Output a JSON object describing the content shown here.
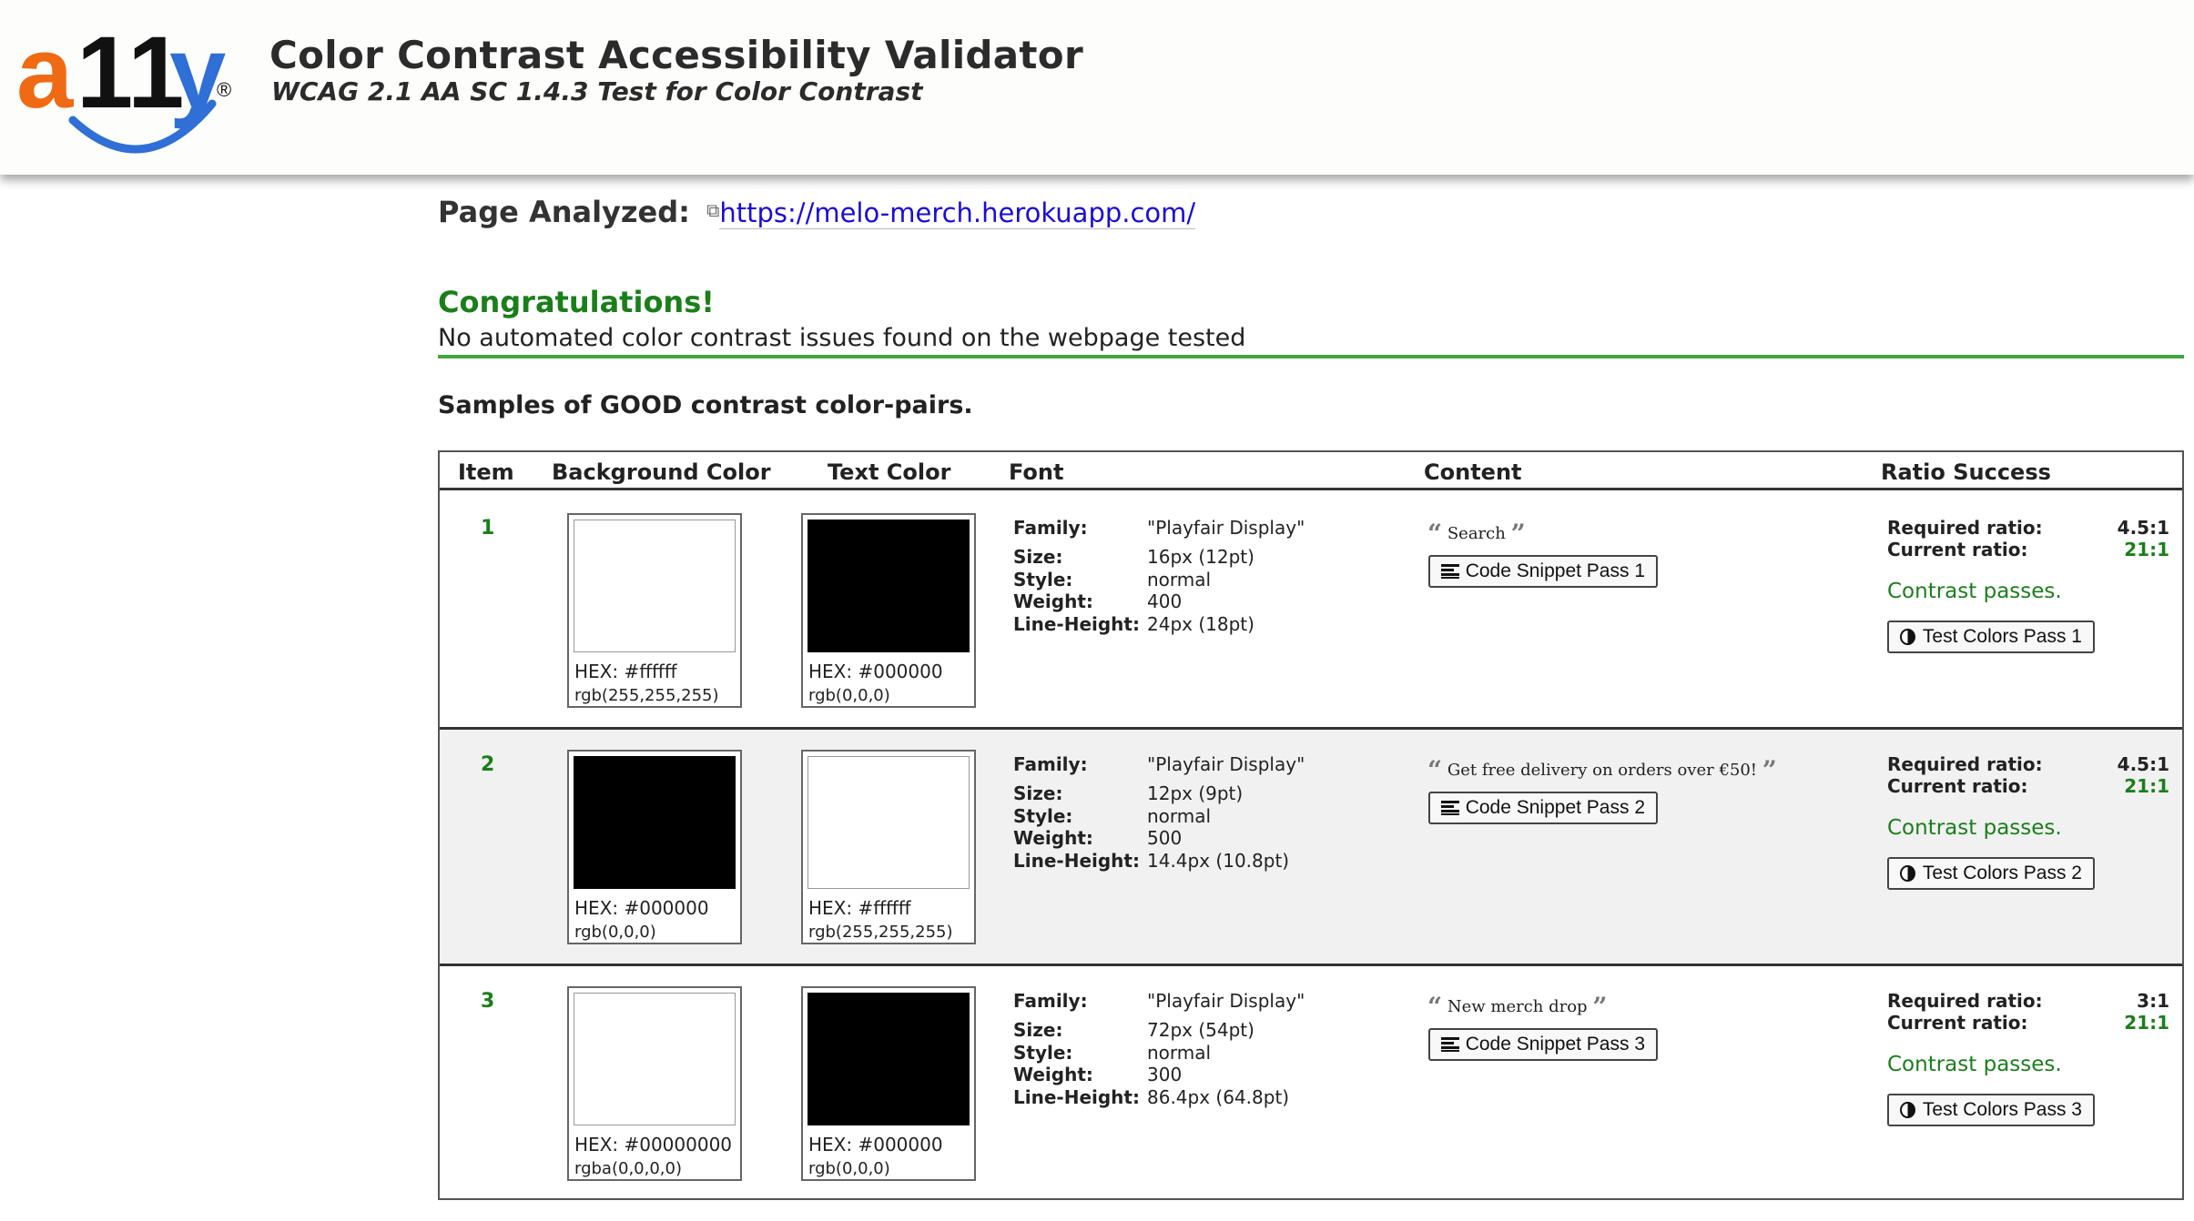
{
  "header": {
    "title": "Color Contrast Accessibility Validator",
    "subtitle": "WCAG 2.1 AA SC 1.4.3 Test for Color Contrast",
    "logo_text": "a11y",
    "logo_mark": "®"
  },
  "page": {
    "label": "Page Analyzed:",
    "url": "https://melo-merch.herokuapp.com/"
  },
  "result": {
    "heading": "Congratulations!",
    "message": "No automated color contrast issues found on the webpage tested"
  },
  "samples_heading": "Samples of GOOD contrast color-pairs.",
  "table": {
    "headers": {
      "item": "Item",
      "background": "Background Color",
      "text": "Text Color",
      "font": "Font",
      "content": "Content",
      "ratio": "Ratio Success"
    },
    "font_labels": {
      "family": "Family:",
      "size": "Size:",
      "style": "Style:",
      "weight": "Weight:",
      "line_height": "Line-Height:"
    },
    "ratio_labels": {
      "required": "Required ratio:",
      "current": "Current ratio:"
    },
    "rows": [
      {
        "item": "1",
        "bg": {
          "hex": "HEX: #ffffff",
          "rgb": "rgb(255,255,255)",
          "color": "#ffffff"
        },
        "fg": {
          "hex": "HEX: #000000",
          "rgb": "rgb(0,0,0)",
          "color": "#000000"
        },
        "font": {
          "family": "\"Playfair Display\"",
          "size": "16px (12pt)",
          "style": "normal",
          "weight": "400",
          "line_height": "24px (18pt)"
        },
        "content": "Search",
        "snippet_btn": "Code Snippet Pass 1",
        "required": "4.5:1",
        "current": "21:1",
        "status": "Contrast passes.",
        "test_btn": "Test Colors Pass 1"
      },
      {
        "item": "2",
        "bg": {
          "hex": "HEX: #000000",
          "rgb": "rgb(0,0,0)",
          "color": "#000000"
        },
        "fg": {
          "hex": "HEX: #ffffff",
          "rgb": "rgb(255,255,255)",
          "color": "#ffffff"
        },
        "font": {
          "family": "\"Playfair Display\"",
          "size": "12px (9pt)",
          "style": "normal",
          "weight": "500",
          "line_height": "14.4px (10.8pt)"
        },
        "content": "Get free delivery on orders over €50!",
        "snippet_btn": "Code Snippet Pass 2",
        "required": "4.5:1",
        "current": "21:1",
        "status": "Contrast passes.",
        "test_btn": "Test Colors Pass 2"
      },
      {
        "item": "3",
        "bg": {
          "hex": "HEX: #00000000",
          "rgb": "rgba(0,0,0,0)",
          "color": "#ffffff"
        },
        "fg": {
          "hex": "HEX: #000000",
          "rgb": "rgb(0,0,0)",
          "color": "#000000"
        },
        "font": {
          "family": "\"Playfair Display\"",
          "size": "72px (54pt)",
          "style": "normal",
          "weight": "300",
          "line_height": "86.4px (64.8pt)"
        },
        "content": "New merch drop",
        "snippet_btn": "Code Snippet Pass 3",
        "required": "3:1",
        "current": "21:1",
        "status": "Contrast passes.",
        "test_btn": "Test Colors Pass 3"
      }
    ]
  },
  "colors": {
    "logo_orange": "#f06a13",
    "logo_blue": "#2f6fd6",
    "success_green": "#1a7f1a",
    "link_blue": "#1a0dd6"
  }
}
